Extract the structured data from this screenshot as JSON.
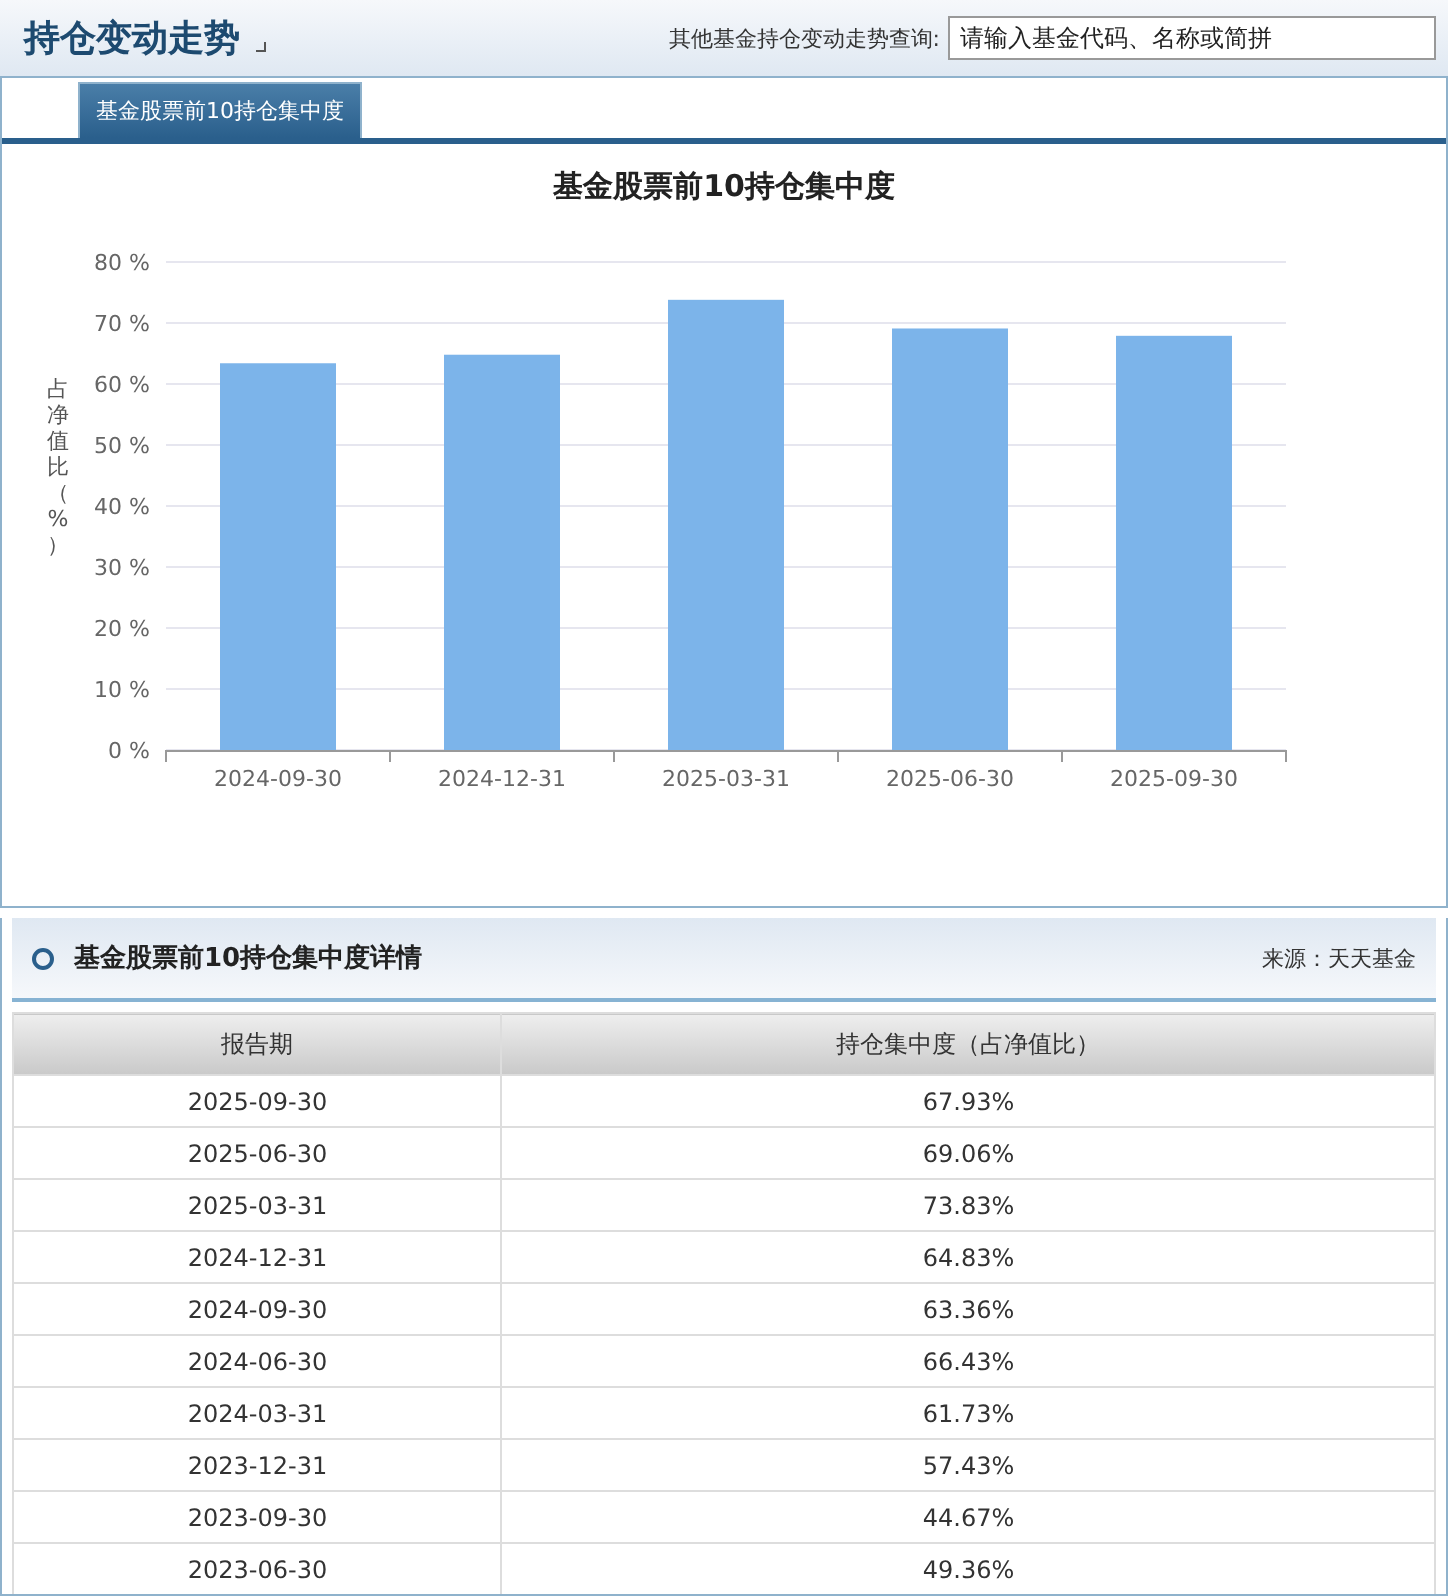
{
  "header": {
    "title": "持仓变动走势",
    "search_label": "其他基金持仓变动走势查询:",
    "search_placeholder": "请输入基金代码、名称或简拼"
  },
  "tabs": [
    {
      "label": "基金股票前10持仓集中度",
      "selected": true
    }
  ],
  "chart": {
    "chart_data": {
      "type": "bar",
      "title": "基金股票前10持仓集中度",
      "ylabel": "占净值比（%）",
      "categories": [
        "2024-09-30",
        "2024-12-31",
        "2025-03-31",
        "2025-06-30",
        "2025-09-30"
      ],
      "series": [
        {
          "color": "#7cb4ea",
          "values": [
            63.4,
            64.8,
            73.8,
            69.1,
            67.9
          ]
        }
      ],
      "grid": true,
      "ylim": [
        0,
        80
      ],
      "yticks": [
        {
          "value": 0,
          "label": "0 %"
        },
        {
          "value": 10,
          "label": "10 %"
        },
        {
          "value": 20,
          "label": "20 %"
        },
        {
          "value": 30,
          "label": "30 %"
        },
        {
          "value": 40,
          "label": "40 %"
        },
        {
          "value": 50,
          "label": "50 %"
        },
        {
          "value": 60,
          "label": "60 %"
        },
        {
          "value": 70,
          "label": "70 %"
        },
        {
          "value": 80,
          "label": "80 %"
        }
      ]
    }
  },
  "detail": {
    "title": "基金股票前10持仓集中度详情",
    "source": "来源：天天基金",
    "columns": [
      "报告期",
      "持仓集中度（占净值比）"
    ],
    "rows": [
      [
        "2025-09-30",
        "67.93%"
      ],
      [
        "2025-06-30",
        "69.06%"
      ],
      [
        "2025-03-31",
        "73.83%"
      ],
      [
        "2024-12-31",
        "64.83%"
      ],
      [
        "2024-09-30",
        "63.36%"
      ],
      [
        "2024-06-30",
        "66.43%"
      ],
      [
        "2024-03-31",
        "61.73%"
      ],
      [
        "2023-12-31",
        "57.43%"
      ],
      [
        "2023-09-30",
        "44.67%"
      ],
      [
        "2023-06-30",
        "49.36%"
      ]
    ]
  }
}
